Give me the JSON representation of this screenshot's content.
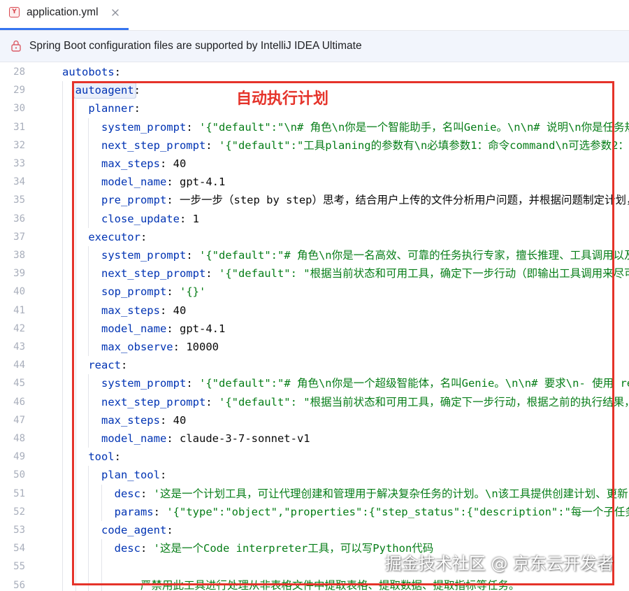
{
  "tab": {
    "icon": "yaml-file-icon",
    "icon_letter": "Y",
    "title": "application.yml",
    "close_icon": "close-icon",
    "active": true
  },
  "banner": {
    "icon": "lock-icon",
    "text": "Spring Boot configuration files are supported by IntelliJ IDEA Ultimate"
  },
  "editor": {
    "key_separator": ":",
    "lines": [
      {
        "n": "28",
        "indent": 0,
        "key": "autobots"
      },
      {
        "n": "29",
        "indent": 2,
        "key": "autoagent",
        "key_highlighted": true
      },
      {
        "n": "30",
        "indent": 4,
        "key": "planner"
      },
      {
        "n": "31",
        "indent": 6,
        "key": "system_prompt",
        "value": "'{\"default\":\"\\n# 角色\\n你是一个智能助手，名叫Genie。\\n\\n# 说明\\n你是任务规"
      },
      {
        "n": "32",
        "indent": 6,
        "key": "next_step_prompt",
        "value": "'{\"default\":\"工具planing的参数有\\n必填参数1：命令command\\n可选参数2："
      },
      {
        "n": "33",
        "indent": 6,
        "key": "max_steps",
        "value": "40"
      },
      {
        "n": "34",
        "indent": 6,
        "key": "model_name",
        "value": "gpt-4.1"
      },
      {
        "n": "35",
        "indent": 6,
        "key": "pre_prompt",
        "value": "一步一步（step by step）思考，结合用户上传的文件分析用户问题，并根据问题制定计划，"
      },
      {
        "n": "36",
        "indent": 6,
        "key": "close_update",
        "value": "1"
      },
      {
        "n": "37",
        "indent": 4,
        "key": "executor"
      },
      {
        "n": "38",
        "indent": 6,
        "key": "system_prompt",
        "value": "'{\"default\":\"# 角色\\n你是一名高效、可靠的任务执行专家，擅长推理、工具调用以及"
      },
      {
        "n": "39",
        "indent": 6,
        "key": "next_step_prompt",
        "value": "'{\"default\": \"根据当前状态和可用工具，确定下一步行动（即输出工具调用来尽可"
      },
      {
        "n": "40",
        "indent": 6,
        "key": "sop_prompt",
        "value": "'{}'"
      },
      {
        "n": "41",
        "indent": 6,
        "key": "max_steps",
        "value": "40"
      },
      {
        "n": "42",
        "indent": 6,
        "key": "model_name",
        "value": "gpt-4.1"
      },
      {
        "n": "43",
        "indent": 6,
        "key": "max_observe",
        "value": "10000"
      },
      {
        "n": "44",
        "indent": 4,
        "key": "react"
      },
      {
        "n": "45",
        "indent": 6,
        "key": "system_prompt",
        "value": "'{\"default\":\"# 角色\\n你是一个超级智能体，名叫Genie。\\n\\n# 要求\\n- 使用 re"
      },
      {
        "n": "46",
        "indent": 6,
        "key": "next_step_prompt",
        "value": "'{\"default\": \"根据当前状态和可用工具，确定下一步行动，根据之前的执行结果，"
      },
      {
        "n": "47",
        "indent": 6,
        "key": "max_steps",
        "value": "40"
      },
      {
        "n": "48",
        "indent": 6,
        "key": "model_name",
        "value": "claude-3-7-sonnet-v1"
      },
      {
        "n": "49",
        "indent": 4,
        "key": "tool"
      },
      {
        "n": "50",
        "indent": 6,
        "key": "plan_tool"
      },
      {
        "n": "51",
        "indent": 8,
        "key": "desc",
        "value": "'这是一个计划工具，可让代理创建和管理用于解决复杂任务的计划。\\n该工具提供创建计划、更新"
      },
      {
        "n": "52",
        "indent": 8,
        "key": "params",
        "value": "'{\"type\":\"object\",\"properties\":{\"step_status\":{\"description\":\"每一个子任务"
      },
      {
        "n": "53",
        "indent": 6,
        "key": "code_agent"
      },
      {
        "n": "54",
        "indent": 8,
        "key": "desc",
        "value": "'这是一个Code interpreter工具，可以写Python代码"
      },
      {
        "n": "55"
      },
      {
        "n": "56",
        "indent": 12,
        "text": "严禁用此工具进行处理从非表格文件中提取表格、提取数据、提取指标等任务。"
      }
    ]
  },
  "annotation": {
    "label": "自动执行计划"
  },
  "watermark": {
    "text": "掘金技术社区 @ 京东云开发者"
  },
  "colors": {
    "accent": "#3574f0",
    "yaml_icon": "#d9474f",
    "banner_bg": "#f2f5fc",
    "key": "#0033b3",
    "string": "#067d17",
    "plain": "#080808",
    "line_number": "#a8aebb",
    "annotation": "#e5332a"
  }
}
